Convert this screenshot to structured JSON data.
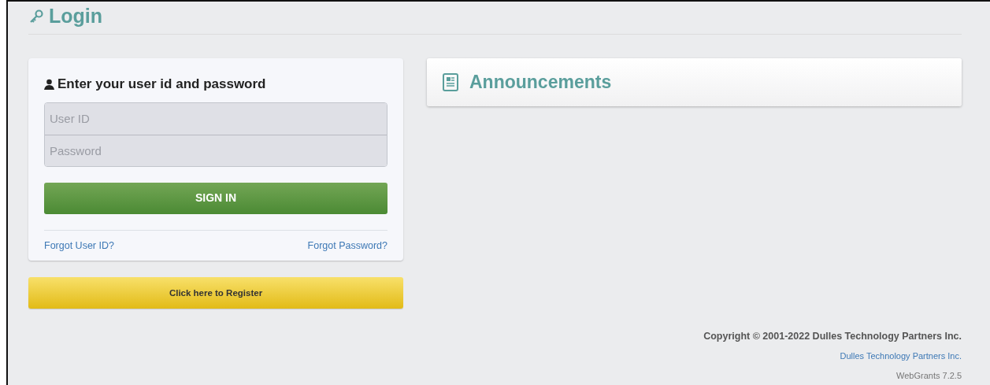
{
  "page": {
    "title": "Login"
  },
  "login": {
    "heading": "Enter your user id and password",
    "fields": [
      {
        "placeholder": "User ID"
      },
      {
        "placeholder": "Password"
      }
    ],
    "submit": "SIGN IN",
    "links": [
      "Forgot User ID?",
      "Forgot Password?"
    ]
  },
  "register": "Click here to Register",
  "announcements": {
    "title": "Announcements"
  },
  "footer": {
    "copyright": "Copyright © 2001-2022 Dulles Technology Partners Inc.",
    "company_link": "Dulles Technology Partners Inc.",
    "version": "WebGrants 7.2.5"
  }
}
